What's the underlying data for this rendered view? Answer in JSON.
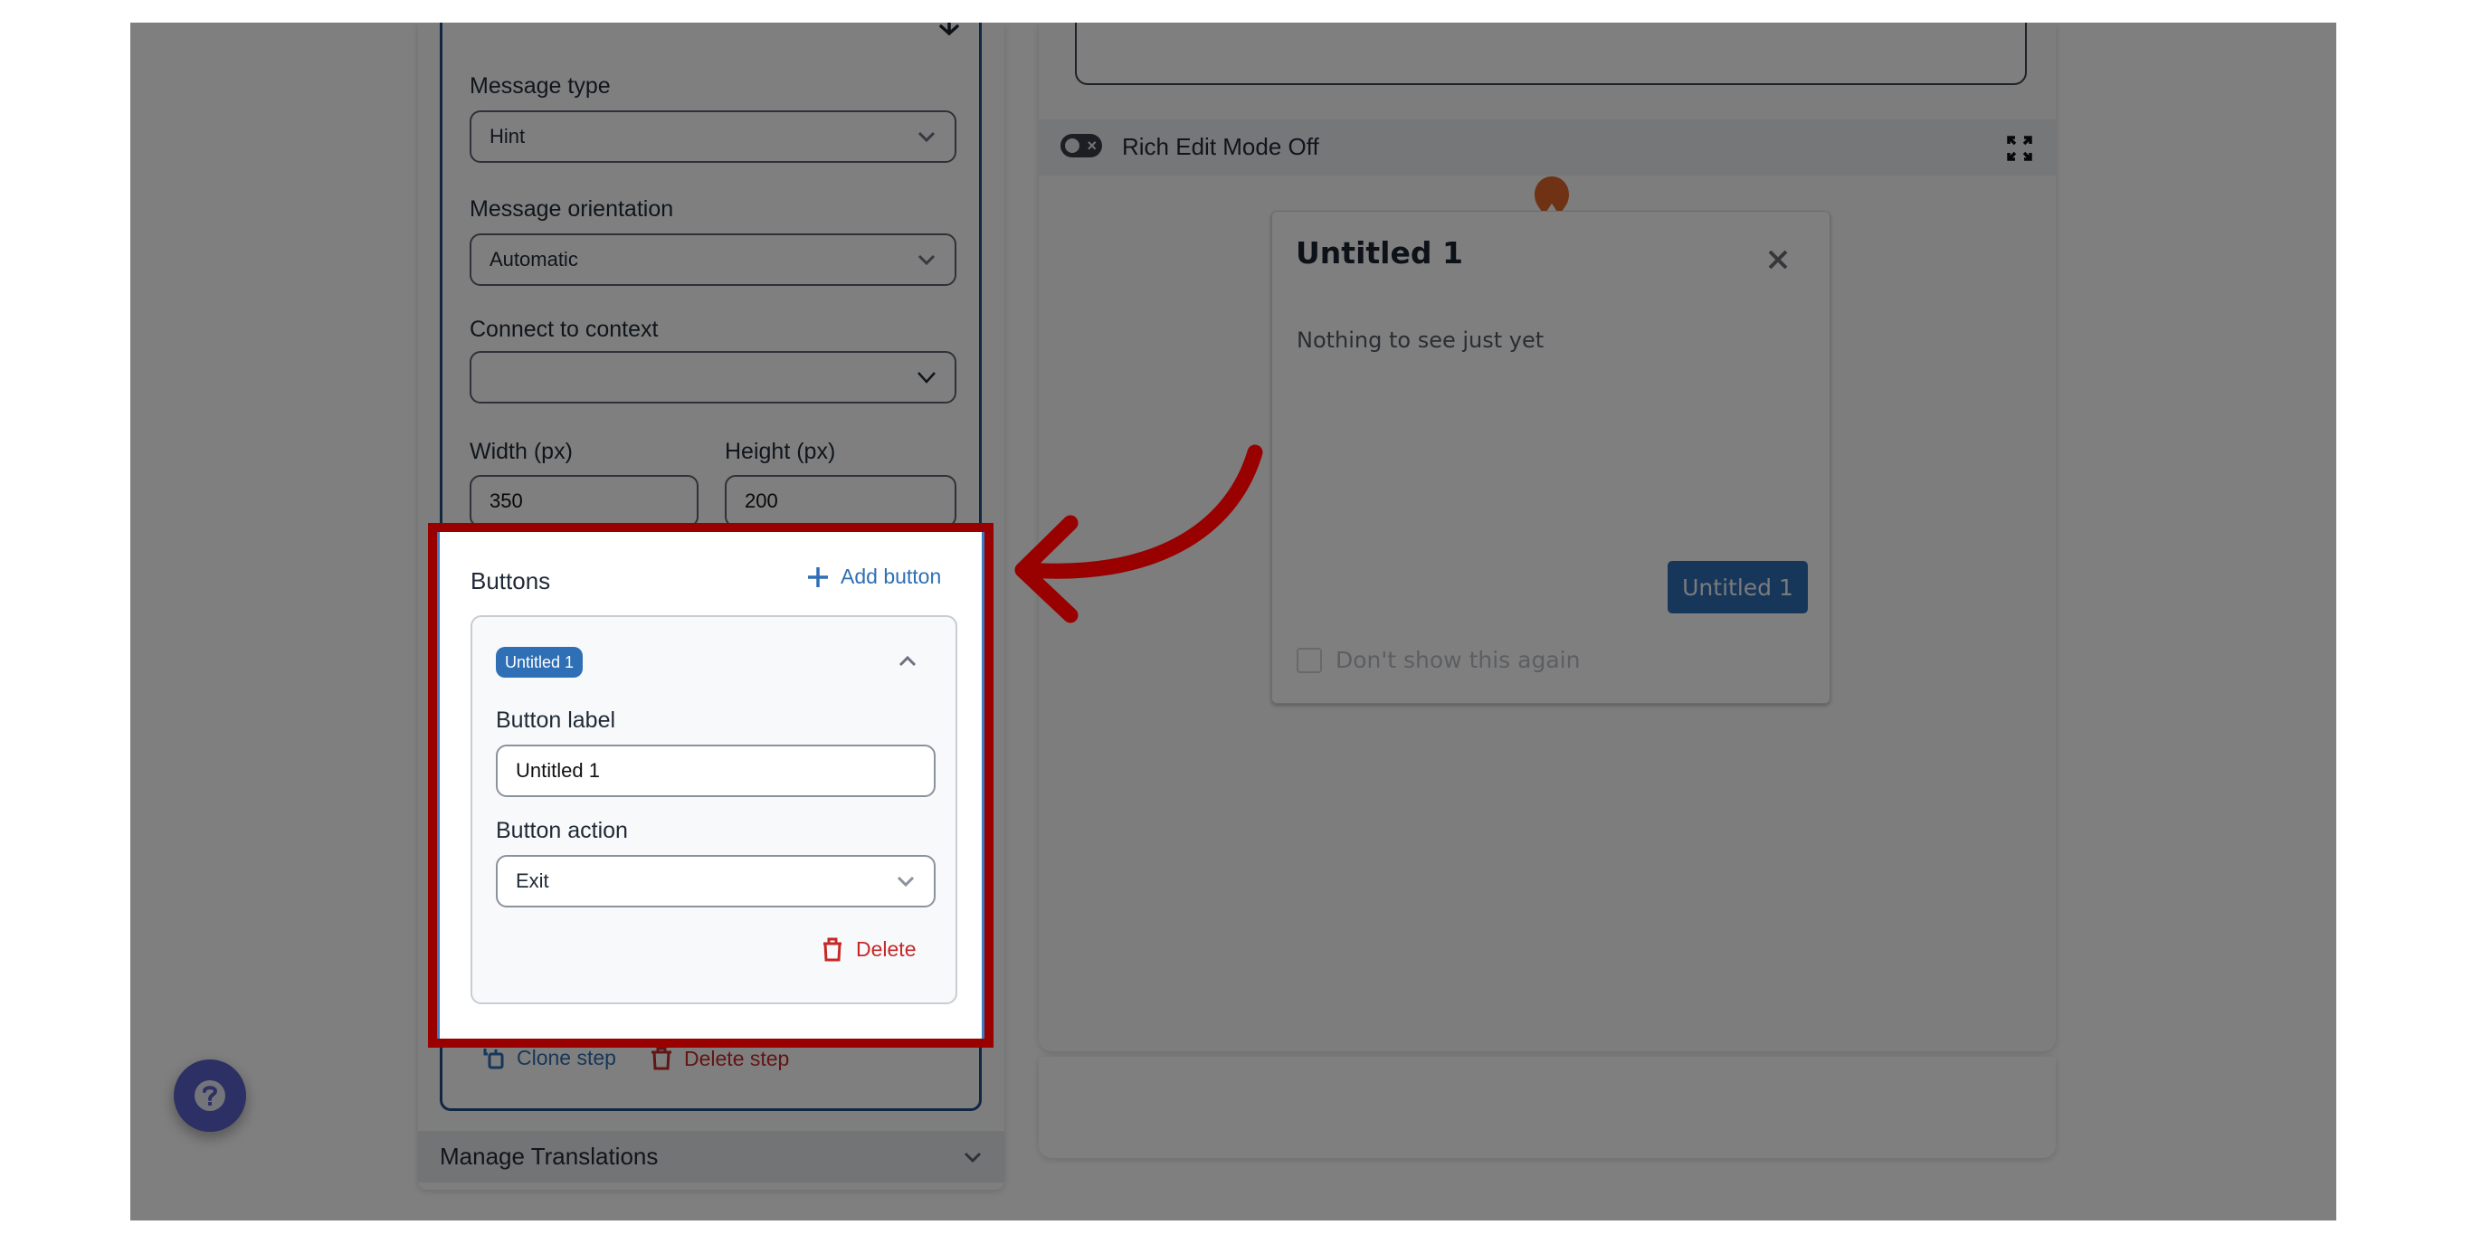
{
  "editor": {
    "message_type": {
      "label": "Message type",
      "value": "Hint"
    },
    "message_orientation": {
      "label": "Message orientation",
      "value": "Automatic"
    },
    "connect_to_context": {
      "label": "Connect to context",
      "value": ""
    },
    "width": {
      "label": "Width (px)",
      "value": "350"
    },
    "height": {
      "label": "Height (px)",
      "value": "200"
    },
    "buttons": {
      "title": "Buttons",
      "add_label": "Add button",
      "items": [
        {
          "badge": "Untitled 1",
          "label_field": {
            "label": "Button label",
            "value": "Untitled 1"
          },
          "action_field": {
            "label": "Button action",
            "value": "Exit"
          },
          "delete_label": "Delete"
        }
      ]
    },
    "step_actions": {
      "clone": "Clone step",
      "delete": "Delete step"
    },
    "manage_translations": "Manage Translations"
  },
  "preview": {
    "rich_edit_label": "Rich Edit Mode Off",
    "rich_edit_on": false,
    "hint": {
      "title": "Untitled 1",
      "body": "Nothing to see just yet",
      "button_label": "Untitled 1",
      "dont_show_label": "Don't show this again",
      "dont_show_checked": false
    }
  },
  "annotation": {
    "highlight_color": "#990000",
    "target": "Buttons section"
  },
  "colors": {
    "accent": "#2e6fb5",
    "danger": "#c62828",
    "beacon": "#e0642a",
    "help": "#5a61c9"
  },
  "icons": {
    "help": "question-circle-icon",
    "add": "plus-icon",
    "delete": "trash-icon",
    "clone": "copy-icon",
    "expand": "expand-icon",
    "close": "close-icon",
    "toggle": "toggle-off-icon"
  }
}
